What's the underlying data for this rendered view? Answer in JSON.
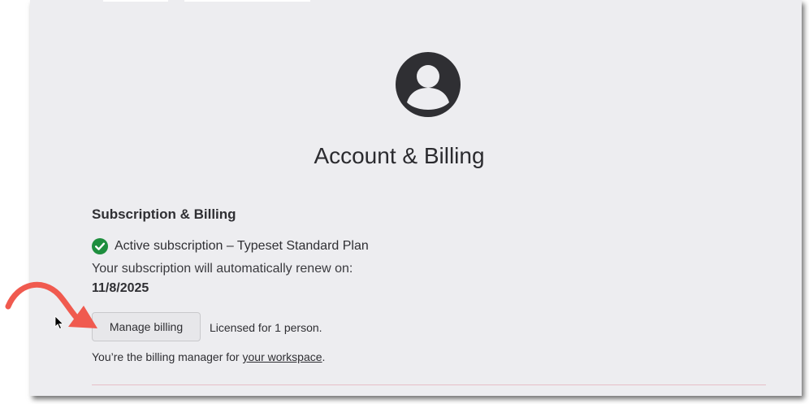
{
  "page": {
    "title": "Account & Billing"
  },
  "subscription": {
    "section_title": "Subscription & Billing",
    "status": "Active subscription – Typeset Standard Plan",
    "renew_label": "Your subscription will automatically renew on:",
    "renew_date": "11/8/2025",
    "manage_button": "Manage billing",
    "licensed_text": "Licensed for 1 person.",
    "billing_manager_prefix": "You’re the billing manager for ",
    "workspace_link": "your workspace",
    "billing_manager_suffix": "."
  },
  "icons": {
    "avatar": "user-avatar-icon",
    "status": "check-circle-icon",
    "annotation": "red-arrow-icon",
    "cursor": "mouse-cursor-icon"
  },
  "colors": {
    "background": "#ededf0",
    "status_check": "#1e8e3e",
    "annotation_arrow": "#f05a4f",
    "avatar": "#2f2f33",
    "divider": "#e6bfc8"
  }
}
